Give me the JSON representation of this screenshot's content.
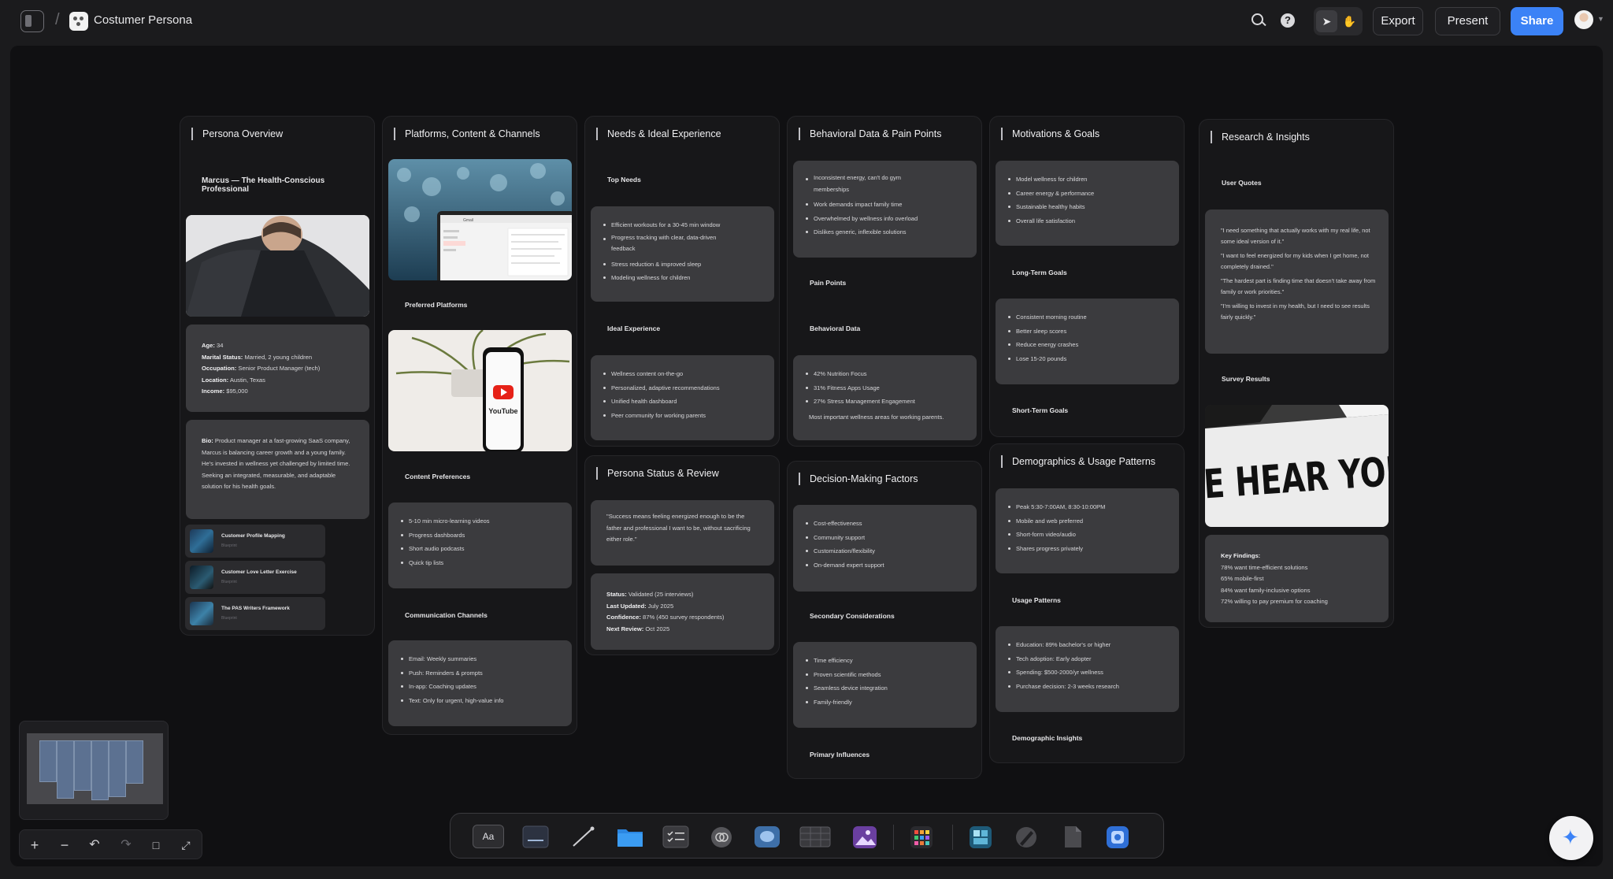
{
  "topbar": {
    "title": "Costumer Persona",
    "export": "Export",
    "present": "Present",
    "share": "Share",
    "separator": "/"
  },
  "columns": {
    "persona_overview": {
      "title": "Persona Overview",
      "name": "Marcus — The Health-Conscious Professional",
      "details": [
        {
          "k": "Age:",
          "v": " 34"
        },
        {
          "k": "Marital Status:",
          "v": " Married, 2 young children"
        },
        {
          "k": "Occupation:",
          "v": " Senior Product Manager (tech)"
        },
        {
          "k": "Location:",
          "v": " Austin, Texas"
        },
        {
          "k": "Income:",
          "v": " $95,000"
        }
      ],
      "bio_label": "Bio:",
      "bio": " Product manager at a fast-growing SaaS company, Marcus is balancing career growth and a young family. He's invested in wellness yet challenged by limited time. Seeking an integrated, measurable, and adaptable solution for his health goals.",
      "refs": [
        {
          "title": "Customer Profile Mapping",
          "sub": "Blueprint"
        },
        {
          "title": "Customer Love Letter Exercise",
          "sub": "Blueprint"
        },
        {
          "title": "The PAS Writers Framework",
          "sub": "Blueprint"
        }
      ]
    },
    "platforms": {
      "title": "Platforms, Content & Channels",
      "preferred_platforms": "Preferred Platforms",
      "content_preferences": "Content Preferences",
      "content_items": [
        "5-10 min micro-learning videos",
        "Progress dashboards",
        "Short audio podcasts",
        "Quick tip lists"
      ],
      "communication_channels": "Communication Channels",
      "channel_items": [
        "Email: Weekly summaries",
        "Push: Reminders & prompts",
        "In-app: Coaching updates",
        "Text: Only for urgent, high-value info"
      ],
      "youtube": "YouTube",
      "gmail": "Gmail"
    },
    "needs": {
      "title": "Needs & Ideal Experience",
      "top_needs": "Top Needs",
      "needs_items": [
        "Efficient workouts for a 30-45 min window",
        "Progress tracking with clear, data-driven feedback",
        "Stress reduction & improved sleep",
        "Modeling wellness for children"
      ],
      "ideal_experience": "Ideal Experience",
      "ideal_items": [
        "Wellness content on-the-go",
        "Personalized, adaptive recommendations",
        "Unified health dashboard",
        "Peer community for working parents"
      ]
    },
    "status": {
      "title": "Persona Status & Review",
      "quote": "\"Success means feeling energized enough to be the father and professional I want to be, without sacrificing either role.\"",
      "rows": [
        {
          "k": "Status:",
          "v": " Validated (25 interviews)"
        },
        {
          "k": "Last Updated:",
          "v": " July 2025"
        },
        {
          "k": "Confidence:",
          "v": " 87% (450 survey respondents)"
        },
        {
          "k": "Next Review:",
          "v": " Oct 2025"
        }
      ]
    },
    "behavioral": {
      "title": "Behavioral Data & Pain Points",
      "pain_items": [
        "Inconsistent energy, can't do gym memberships",
        "Work demands impact family time",
        "Overwhelmed by wellness info overload",
        "Dislikes generic, inflexible solutions"
      ],
      "pain_points": "Pain Points",
      "behavioral_data": "Behavioral Data",
      "data_items": [
        "42% Nutrition Focus",
        "31% Fitness Apps Usage",
        "27% Stress Management Engagement"
      ],
      "data_note": "Most important wellness areas for working parents."
    },
    "decision": {
      "title": "Decision-Making Factors",
      "primary_items": [
        "Cost-effectiveness",
        "Community support",
        "Customization/flexibility",
        "On-demand expert support"
      ],
      "secondary": "Secondary Considerations",
      "secondary_items": [
        "Time efficiency",
        "Proven scientific methods",
        "Seamless device integration",
        "Family-friendly"
      ],
      "primary": "Primary Influences"
    },
    "motivations": {
      "title": "Motivations & Goals",
      "motive_items": [
        "Model wellness for children",
        "Career energy & performance",
        "Sustainable healthy habits",
        "Overall life satisfaction"
      ],
      "long_term": "Long-Term Goals",
      "long_items": [
        "Consistent morning routine",
        "Better sleep scores",
        "Reduce energy crashes",
        "Lose 15-20 pounds"
      ],
      "short_term": "Short-Term Goals"
    },
    "demographics": {
      "title": "Demographics & Usage Patterns",
      "usage_items": [
        "Peak 5:30-7:00AM, 8:30-10:00PM",
        "Mobile and web preferred",
        "Short-form video/audio",
        "Shares progress privately"
      ],
      "usage_patterns": "Usage Patterns",
      "demo_items": [
        "Education: 89% bachelor's or higher",
        "Tech adoption: Early adopter",
        "Spending: $500-2000/yr wellness",
        "Purchase decision: 2-3 weeks research"
      ],
      "demographic_insights": "Demographic Insights"
    },
    "research": {
      "title": "Research & Insights",
      "user_quotes": "User Quotes",
      "quotes": [
        "\"I need something that actually works with my real life, not some ideal version of it.\"",
        "\"I want to feel energized for my kids when I get home, not completely drained.\"",
        "\"The hardest part is finding time that doesn't take away from family or work priorities.\"",
        "\"I'm willing to invest in my health, but I need to see results fairly quickly.\""
      ],
      "survey_results": "Survey Results",
      "sign_text": "WE HEAR YOU.",
      "key_findings": "Key Findings:",
      "findings": [
        "78% want time-efficient solutions",
        "65% mobile-first",
        "84% want family-inclusive options",
        "72% willing to pay premium for coaching"
      ]
    }
  },
  "bottom_toolbar": {
    "text_tool": "Aa"
  },
  "icons": [
    "sidebar-toggle-icon",
    "document-icon",
    "search-icon",
    "help-icon",
    "pointer-icon",
    "hand-icon",
    "sparkle-icon",
    "plus-icon",
    "minus-icon",
    "undo-icon",
    "redo-icon",
    "crop-icon",
    "expand-icon"
  ]
}
